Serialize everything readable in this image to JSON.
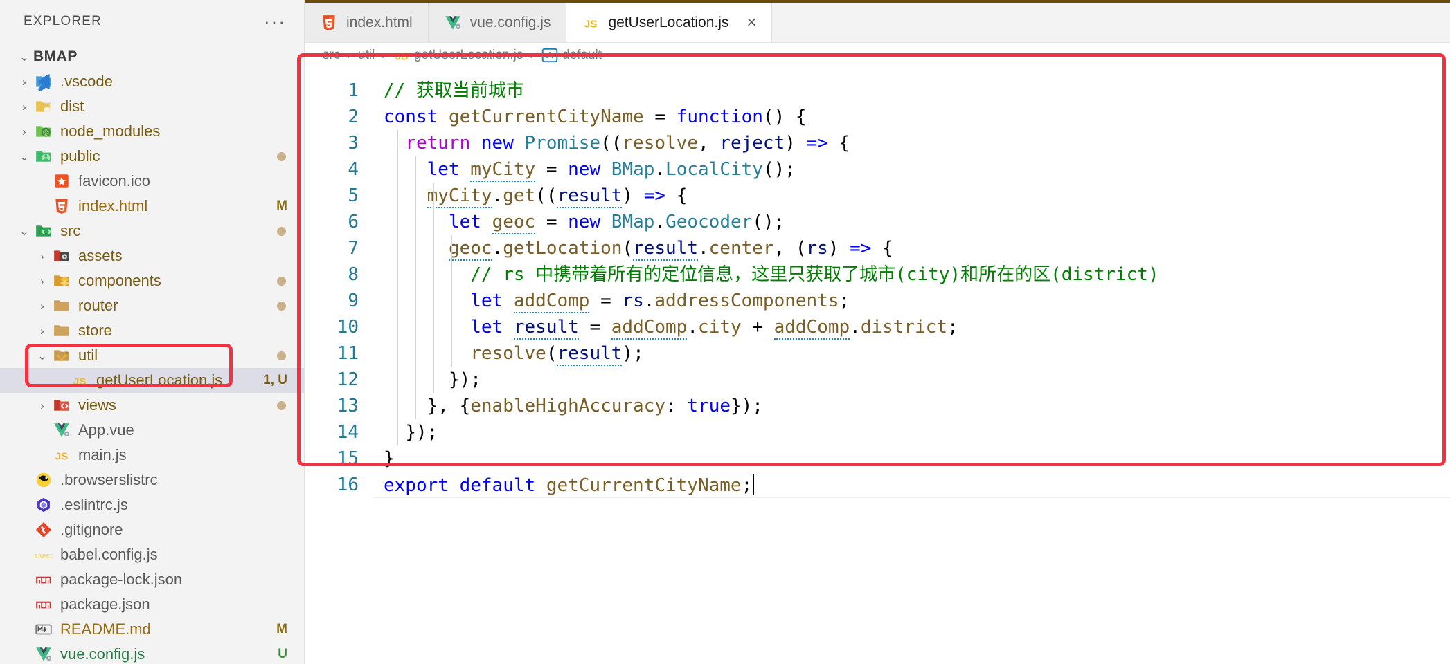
{
  "sidebar": {
    "title": "EXPLORER",
    "more_label": "···",
    "root": {
      "label": "BMAP",
      "twisty": "⌄"
    },
    "items": [
      {
        "label": ".vscode",
        "icon": "vscode-folder-icon",
        "kind": "folder",
        "indent": 1,
        "twisty": "›",
        "badge": "",
        "dot": false,
        "selected": false
      },
      {
        "label": "dist",
        "icon": "dist-folder-icon",
        "kind": "folder",
        "indent": 1,
        "twisty": "›",
        "badge": "",
        "dot": false,
        "selected": false
      },
      {
        "label": "node_modules",
        "icon": "node-folder-icon",
        "kind": "folder",
        "indent": 1,
        "twisty": "›",
        "badge": "",
        "dot": false,
        "selected": false
      },
      {
        "label": "public",
        "icon": "public-folder-icon",
        "kind": "folder",
        "indent": 1,
        "twisty": "⌄",
        "badge": "",
        "dot": true,
        "selected": false
      },
      {
        "label": "favicon.ico",
        "icon": "favicon-file-icon",
        "kind": "file",
        "indent": 2,
        "twisty": "",
        "badge": "",
        "dot": false,
        "selected": false
      },
      {
        "label": "index.html",
        "icon": "html5-file-icon",
        "kind": "file",
        "indent": 2,
        "twisty": "",
        "badge": "M",
        "dot": false,
        "selected": false
      },
      {
        "label": "src",
        "icon": "src-folder-icon",
        "kind": "folder",
        "indent": 1,
        "twisty": "⌄",
        "badge": "",
        "dot": true,
        "selected": false
      },
      {
        "label": "assets",
        "icon": "assets-folder-icon",
        "kind": "folder",
        "indent": 2,
        "twisty": "›",
        "badge": "",
        "dot": false,
        "selected": false
      },
      {
        "label": "components",
        "icon": "components-folder-icon",
        "kind": "folder",
        "indent": 2,
        "twisty": "›",
        "badge": "",
        "dot": true,
        "selected": false
      },
      {
        "label": "router",
        "icon": "plain-folder-icon",
        "kind": "folder",
        "indent": 2,
        "twisty": "›",
        "badge": "",
        "dot": true,
        "selected": false
      },
      {
        "label": "store",
        "icon": "plain-folder-icon",
        "kind": "folder",
        "indent": 2,
        "twisty": "›",
        "badge": "",
        "dot": false,
        "selected": false
      },
      {
        "label": "util",
        "icon": "util-folder-icon",
        "kind": "folder",
        "indent": 2,
        "twisty": "⌄",
        "badge": "",
        "dot": true,
        "selected": false
      },
      {
        "label": "getUserLocation.js",
        "icon": "js-file-icon",
        "kind": "js",
        "indent": 3,
        "twisty": "",
        "badge": "1, U",
        "dot": false,
        "selected": true
      },
      {
        "label": "views",
        "icon": "views-folder-icon",
        "kind": "folder",
        "indent": 2,
        "twisty": "›",
        "badge": "",
        "dot": true,
        "selected": false
      },
      {
        "label": "App.vue",
        "icon": "vue-file-icon",
        "kind": "plain",
        "indent": 2,
        "twisty": "",
        "badge": "",
        "dot": false,
        "selected": false
      },
      {
        "label": "main.js",
        "icon": "js-file-icon",
        "kind": "plain",
        "indent": 2,
        "twisty": "",
        "badge": "",
        "dot": false,
        "selected": false
      },
      {
        "label": ".browserslistrc",
        "icon": "browserslist-file-icon",
        "kind": "plain",
        "indent": 1,
        "twisty": "",
        "badge": "",
        "dot": false,
        "selected": false
      },
      {
        "label": ".eslintrc.js",
        "icon": "eslint-file-icon",
        "kind": "plain",
        "indent": 1,
        "twisty": "",
        "badge": "",
        "dot": false,
        "selected": false
      },
      {
        "label": ".gitignore",
        "icon": "git-file-icon",
        "kind": "plain",
        "indent": 1,
        "twisty": "",
        "badge": "",
        "dot": false,
        "selected": false
      },
      {
        "label": "babel.config.js",
        "icon": "babel-file-icon",
        "kind": "plain",
        "indent": 1,
        "twisty": "",
        "badge": "",
        "dot": false,
        "selected": false
      },
      {
        "label": "package-lock.json",
        "icon": "npm-file-icon",
        "kind": "plain",
        "indent": 1,
        "twisty": "",
        "badge": "",
        "dot": false,
        "selected": false
      },
      {
        "label": "package.json",
        "icon": "npm-file-icon",
        "kind": "plain",
        "indent": 1,
        "twisty": "",
        "badge": "",
        "dot": false,
        "selected": false
      },
      {
        "label": "README.md",
        "icon": "markdown-file-icon",
        "kind": "md",
        "indent": 1,
        "twisty": "",
        "badge": "M",
        "dot": false,
        "selected": false
      },
      {
        "label": "vue.config.js",
        "icon": "vue-file-icon",
        "kind": "vue",
        "indent": 1,
        "twisty": "",
        "badge": "U",
        "dot": false,
        "selected": false
      }
    ]
  },
  "tabs": [
    {
      "label": "index.html",
      "icon": "html5-file-icon",
      "active": false,
      "closable": false
    },
    {
      "label": "vue.config.js",
      "icon": "vue-file-icon",
      "active": false,
      "closable": false
    },
    {
      "label": "getUserLocation.js",
      "icon": "js-file-icon",
      "active": true,
      "closable": true,
      "close_label": "×"
    }
  ],
  "breadcrumb": {
    "separator": "›",
    "crumbs": [
      {
        "label": "src",
        "icon": ""
      },
      {
        "label": "util",
        "icon": ""
      },
      {
        "label": "getUserLocation.js",
        "icon": "js-file-icon"
      },
      {
        "label": "default",
        "icon": "symbol-field-icon"
      }
    ]
  },
  "editor": {
    "line_numbers": [
      "1",
      "2",
      "3",
      "4",
      "5",
      "6",
      "7",
      "8",
      "9",
      "10",
      "11",
      "12",
      "13",
      "14",
      "15",
      "16"
    ],
    "lines": [
      "// 获取当前城市",
      "const getCurrentCityName = function() {",
      "  return new Promise((resolve, reject) => {",
      "    let myCity = new BMap.LocalCity();",
      "    myCity.get((result) => {",
      "      let geoc = new BMap.Geocoder();",
      "      geoc.getLocation(result.center, (rs) => {",
      "        // rs 中携带着所有的定位信息，这里只获取了城市(city)和所在的区(district)",
      "        let addComp = rs.addressComponents;",
      "        let result = addComp.city + addComp.district;",
      "        resolve(result);",
      "      });",
      "    }, {enableHighAccuracy: true});",
      "  });",
      "}",
      "export default getCurrentCityName;"
    ],
    "language": "javascript",
    "cursor_line": 16
  },
  "annotations": [
    {
      "name": "util-folder-highlight",
      "color": "#f4323f"
    },
    {
      "name": "code-block-highlight",
      "color": "#f4323f"
    }
  ],
  "colors": {
    "accent_red": "#f4323f",
    "sidebar_bg": "#f3f3f3",
    "selection_bg": "#dcdde6",
    "line_number": "#237893",
    "comment": "#008000",
    "keyword": "#0000ff",
    "control": "#af00db",
    "function": "#795e26",
    "variable": "#001080",
    "class": "#267f99",
    "number": "#098658"
  }
}
